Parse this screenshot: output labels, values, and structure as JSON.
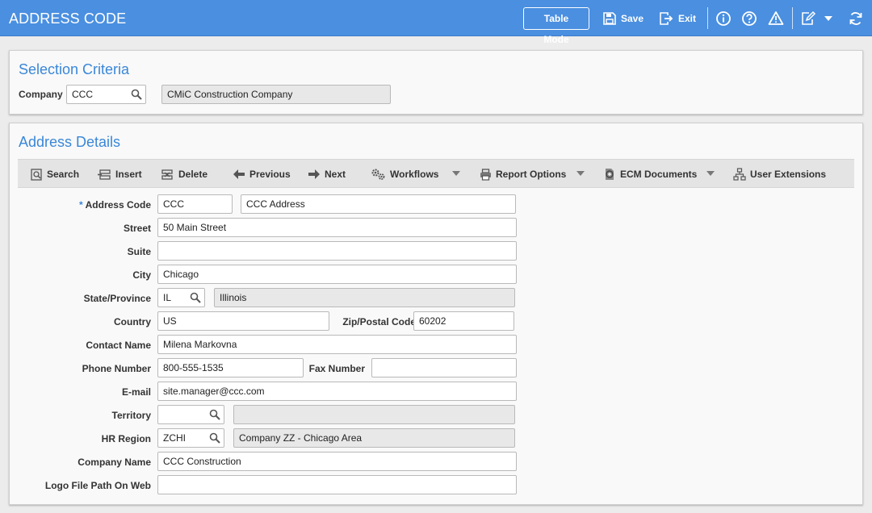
{
  "app": {
    "title": "ADDRESS CODE",
    "table_mode_label": "Table Mode",
    "save_label": "Save",
    "exit_label": "Exit"
  },
  "colors": {
    "header": "#4a8fe0",
    "accent": "#3a87d8"
  },
  "selection": {
    "title": "Selection Criteria",
    "company_label": "Company",
    "company_value": "CCC",
    "company_name": "CMiC Construction Company"
  },
  "details": {
    "title": "Address Details",
    "toolbar": {
      "search": "Search",
      "insert": "Insert",
      "delete": "Delete",
      "previous": "Previous",
      "next": "Next",
      "workflows": "Workflows",
      "report_options": "Report Options",
      "ecm_documents": "ECM Documents",
      "user_extensions": "User Extensions"
    },
    "fields": {
      "address_code_label": "Address Code",
      "address_code": "CCC",
      "address_name": "CCC Address",
      "street_label": "Street",
      "street": "50 Main Street",
      "suite_label": "Suite",
      "suite": "",
      "city_label": "City",
      "city": "Chicago",
      "state_label": "State/Province",
      "state": "IL",
      "state_name": "Illinois",
      "country_label": "Country",
      "country": "US",
      "zip_label": "Zip/Postal Code",
      "zip": "60202",
      "contact_label": "Contact Name",
      "contact": "Milena Markovna",
      "phone_label": "Phone Number",
      "phone": "800-555-1535",
      "fax_label": "Fax Number",
      "fax": "",
      "email_label": "E-mail",
      "email": "site.manager@ccc.com",
      "territory_label": "Territory",
      "territory": "",
      "territory_name": "",
      "hr_region_label": "HR Region",
      "hr_region": "ZCHI",
      "hr_region_name": "Company ZZ - Chicago Area",
      "company_name_label": "Company Name",
      "company_name": "CCC Construction",
      "logo_label": "Logo File Path On Web",
      "logo": ""
    }
  }
}
